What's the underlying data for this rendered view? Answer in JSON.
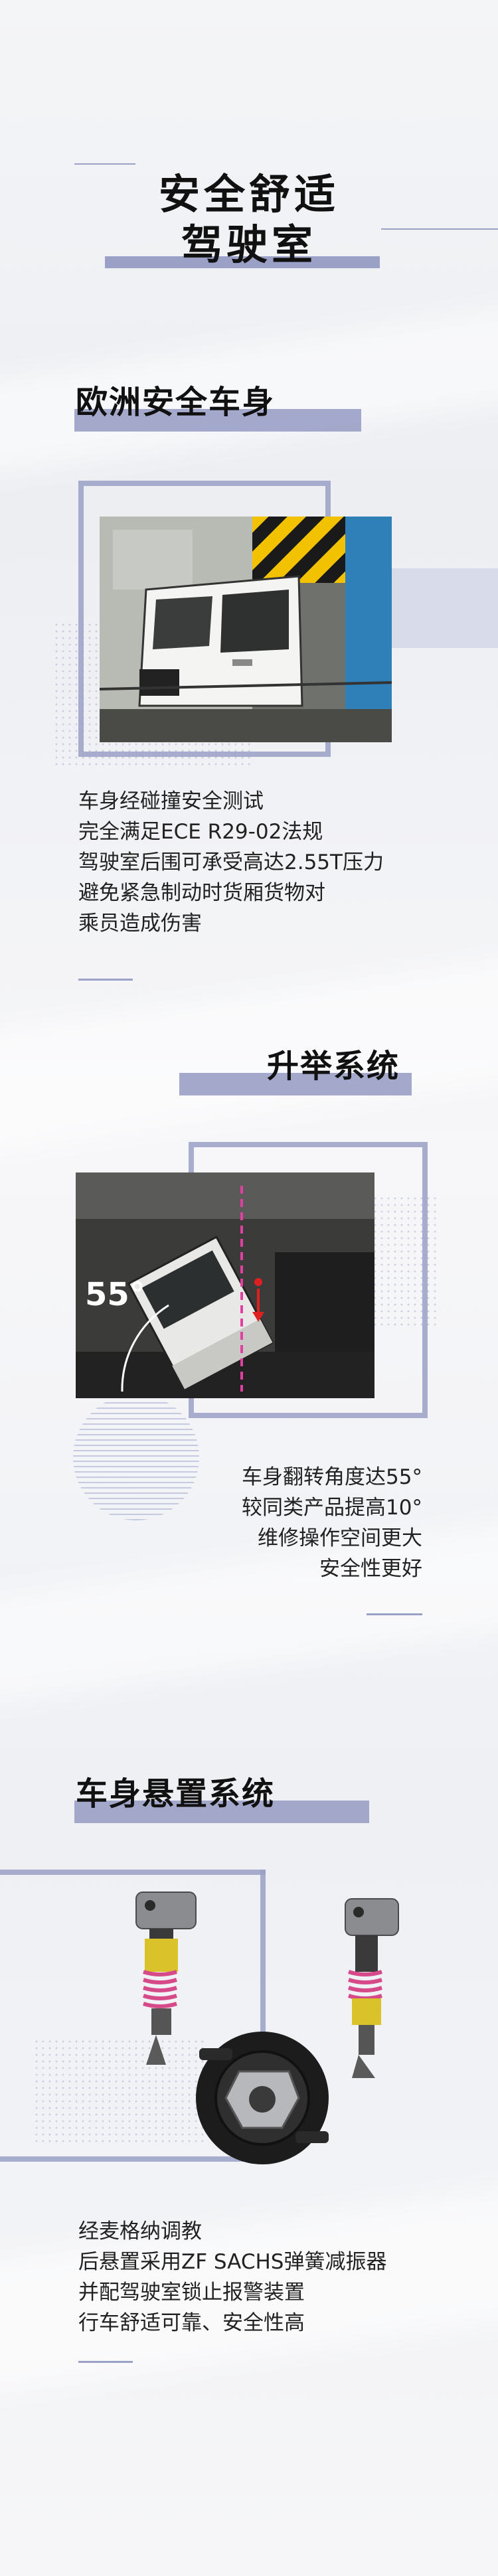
{
  "hero": {
    "line1": "安全舒适",
    "line2": "驾驶室"
  },
  "section1": {
    "title": "欧洲安全车身",
    "lines": [
      "车身经碰撞安全测试",
      "完全满足ECE R29-02法规",
      "驾驶室后围可承受高达2.55T压力",
      "避免紧急制动时货厢货物对",
      "乘员造成伤害"
    ]
  },
  "section2": {
    "title": "升举系统",
    "angle_label": "55°",
    "lines": [
      "车身翻转角度达55°",
      "较同类产品提高10°",
      "维修操作空间更大",
      "安全性更好"
    ]
  },
  "section3": {
    "title": "车身悬置系统",
    "lines": [
      "经麦格纳调教",
      "后悬置采用ZF SACHS弹簧减振器",
      "并配驾驶室锁止报警装置",
      "行车舒适可靠、安全性高"
    ]
  },
  "colors": {
    "accent": "#9aa0c6",
    "text": "#111111",
    "marker_red": "#e02020",
    "spring_yellow": "#d9c22a",
    "spring_pink": "#d64a8a"
  }
}
